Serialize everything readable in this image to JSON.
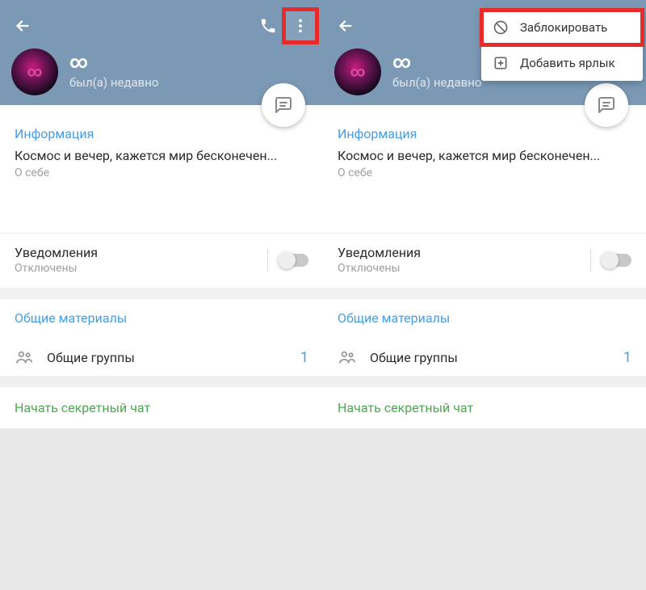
{
  "profile": {
    "name_symbol": "∞",
    "last_seen": "был(а) недавно"
  },
  "info": {
    "label": "Информация",
    "bio": "Космос и вечер, кажется мир бесконечен...",
    "bio_sublabel": "О себе"
  },
  "notifications": {
    "title": "Уведомления",
    "status": "Отключены"
  },
  "shared": {
    "label": "Общие материалы",
    "groups_label": "Общие группы",
    "groups_count": "1"
  },
  "secret_chat": {
    "label": "Начать секретный чат"
  },
  "menu": {
    "block": "Заблокировать",
    "add_label": "Добавить ярлык"
  }
}
